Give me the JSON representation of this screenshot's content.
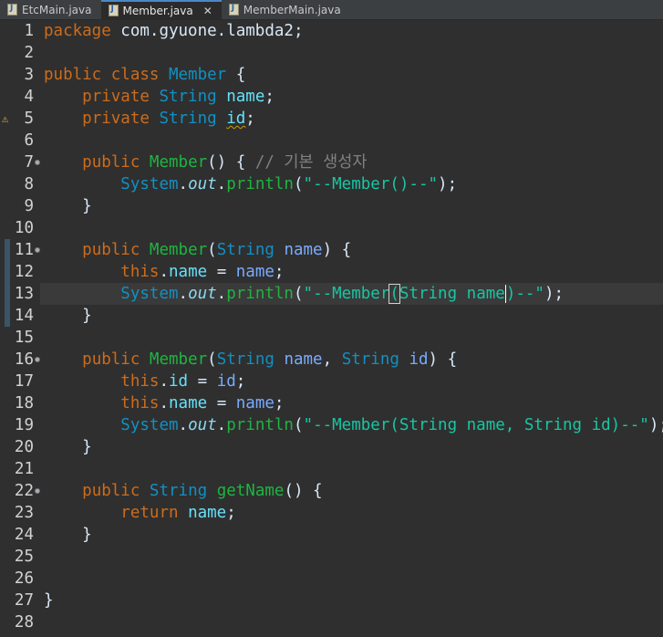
{
  "tabs": [
    {
      "label": "EtcMain.java",
      "active": false
    },
    {
      "label": "Member.java",
      "active": true,
      "close": "✕"
    },
    {
      "label": "MemberMain.java",
      "active": false
    }
  ],
  "gutter": {
    "fold_lines": [
      7,
      11,
      16,
      22
    ],
    "change_bar_lines": [
      11,
      12,
      13,
      14
    ],
    "warning_marker_line": 5,
    "warning_icon": "warning-lightbulb-icon"
  },
  "lines": [
    {
      "n": "1",
      "tokens": [
        {
          "t": "package",
          "c": "kw"
        },
        {
          "t": " com.gyuone.lambda2;",
          "c": "plain"
        }
      ]
    },
    {
      "n": "2",
      "tokens": []
    },
    {
      "n": "3",
      "tokens": [
        {
          "t": "public class ",
          "c": "kw"
        },
        {
          "t": "Member",
          "c": "ty"
        },
        {
          "t": " {",
          "c": "plain"
        }
      ]
    },
    {
      "n": "4",
      "tokens": [
        {
          "t": "    ",
          "c": "plain"
        },
        {
          "t": "private ",
          "c": "kw"
        },
        {
          "t": "String ",
          "c": "ty"
        },
        {
          "t": "name",
          "c": "fld"
        },
        {
          "t": ";",
          "c": "plain"
        }
      ]
    },
    {
      "n": "5",
      "tokens": [
        {
          "t": "    ",
          "c": "plain"
        },
        {
          "t": "private ",
          "c": "kw"
        },
        {
          "t": "String ",
          "c": "ty"
        },
        {
          "t": "id",
          "c": "fld squiggle"
        },
        {
          "t": ";",
          "c": "plain"
        }
      ]
    },
    {
      "n": "6",
      "tokens": []
    },
    {
      "n": "7",
      "tokens": [
        {
          "t": "    ",
          "c": "plain"
        },
        {
          "t": "public ",
          "c": "kw"
        },
        {
          "t": "Member",
          "c": "fn"
        },
        {
          "t": "() { ",
          "c": "plain"
        },
        {
          "t": "// 기본 생성자",
          "c": "cmt"
        }
      ]
    },
    {
      "n": "8",
      "tokens": [
        {
          "t": "        ",
          "c": "plain"
        },
        {
          "t": "System",
          "c": "ty"
        },
        {
          "t": ".",
          "c": "plain"
        },
        {
          "t": "out",
          "c": "static"
        },
        {
          "t": ".",
          "c": "plain"
        },
        {
          "t": "println",
          "c": "fn"
        },
        {
          "t": "(",
          "c": "plain"
        },
        {
          "t": "\"--Member()--\"",
          "c": "str"
        },
        {
          "t": ");",
          "c": "plain"
        }
      ]
    },
    {
      "n": "9",
      "tokens": [
        {
          "t": "    }",
          "c": "plain"
        }
      ]
    },
    {
      "n": "10",
      "tokens": []
    },
    {
      "n": "11",
      "tokens": [
        {
          "t": "    ",
          "c": "plain"
        },
        {
          "t": "public ",
          "c": "kw"
        },
        {
          "t": "Member",
          "c": "fn"
        },
        {
          "t": "(",
          "c": "plain"
        },
        {
          "t": "String ",
          "c": "ty"
        },
        {
          "t": "name",
          "c": "param"
        },
        {
          "t": ") {",
          "c": "plain"
        }
      ]
    },
    {
      "n": "12",
      "tokens": [
        {
          "t": "        ",
          "c": "plain"
        },
        {
          "t": "this",
          "c": "kw"
        },
        {
          "t": ".",
          "c": "plain"
        },
        {
          "t": "name",
          "c": "fld"
        },
        {
          "t": " = ",
          "c": "plain"
        },
        {
          "t": "name",
          "c": "param"
        },
        {
          "t": ";",
          "c": "plain"
        }
      ]
    },
    {
      "n": "13",
      "current": true,
      "tokens": [
        {
          "t": "        ",
          "c": "plain"
        },
        {
          "t": "System",
          "c": "ty"
        },
        {
          "t": ".",
          "c": "plain"
        },
        {
          "t": "out",
          "c": "static"
        },
        {
          "t": ".",
          "c": "plain"
        },
        {
          "t": "println",
          "c": "fn"
        },
        {
          "t": "(",
          "c": "plain"
        },
        {
          "t": "\"--Member",
          "c": "str"
        },
        {
          "t": "(",
          "c": "str bracket"
        },
        {
          "t": "String name",
          "c": "str"
        },
        {
          "t": ")",
          "c": "str caret"
        },
        {
          "t": "--\"",
          "c": "str"
        },
        {
          "t": ");",
          "c": "plain"
        }
      ]
    },
    {
      "n": "14",
      "tokens": [
        {
          "t": "    }",
          "c": "plain"
        }
      ]
    },
    {
      "n": "15",
      "tokens": []
    },
    {
      "n": "16",
      "tokens": [
        {
          "t": "    ",
          "c": "plain"
        },
        {
          "t": "public ",
          "c": "kw"
        },
        {
          "t": "Member",
          "c": "fn"
        },
        {
          "t": "(",
          "c": "plain"
        },
        {
          "t": "String ",
          "c": "ty"
        },
        {
          "t": "name",
          "c": "param"
        },
        {
          "t": ", ",
          "c": "plain"
        },
        {
          "t": "String ",
          "c": "ty"
        },
        {
          "t": "id",
          "c": "param"
        },
        {
          "t": ") {",
          "c": "plain"
        }
      ]
    },
    {
      "n": "17",
      "tokens": [
        {
          "t": "        ",
          "c": "plain"
        },
        {
          "t": "this",
          "c": "kw"
        },
        {
          "t": ".",
          "c": "plain"
        },
        {
          "t": "id",
          "c": "fld"
        },
        {
          "t": " = ",
          "c": "plain"
        },
        {
          "t": "id",
          "c": "param"
        },
        {
          "t": ";",
          "c": "plain"
        }
      ]
    },
    {
      "n": "18",
      "tokens": [
        {
          "t": "        ",
          "c": "plain"
        },
        {
          "t": "this",
          "c": "kw"
        },
        {
          "t": ".",
          "c": "plain"
        },
        {
          "t": "name",
          "c": "fld"
        },
        {
          "t": " = ",
          "c": "plain"
        },
        {
          "t": "name",
          "c": "param"
        },
        {
          "t": ";",
          "c": "plain"
        }
      ]
    },
    {
      "n": "19",
      "tokens": [
        {
          "t": "        ",
          "c": "plain"
        },
        {
          "t": "System",
          "c": "ty"
        },
        {
          "t": ".",
          "c": "plain"
        },
        {
          "t": "out",
          "c": "static"
        },
        {
          "t": ".",
          "c": "plain"
        },
        {
          "t": "println",
          "c": "fn"
        },
        {
          "t": "(",
          "c": "plain"
        },
        {
          "t": "\"--Member(String name, String id)--\"",
          "c": "str"
        },
        {
          "t": ");",
          "c": "plain"
        }
      ]
    },
    {
      "n": "20",
      "tokens": [
        {
          "t": "    }",
          "c": "plain"
        }
      ]
    },
    {
      "n": "21",
      "tokens": []
    },
    {
      "n": "22",
      "tokens": [
        {
          "t": "    ",
          "c": "plain"
        },
        {
          "t": "public ",
          "c": "kw"
        },
        {
          "t": "String ",
          "c": "ty"
        },
        {
          "t": "getName",
          "c": "fn"
        },
        {
          "t": "() {",
          "c": "plain"
        }
      ]
    },
    {
      "n": "23",
      "tokens": [
        {
          "t": "        ",
          "c": "plain"
        },
        {
          "t": "return ",
          "c": "kw"
        },
        {
          "t": "name",
          "c": "fld"
        },
        {
          "t": ";",
          "c": "plain"
        }
      ]
    },
    {
      "n": "24",
      "tokens": [
        {
          "t": "    }",
          "c": "plain"
        }
      ]
    },
    {
      "n": "25",
      "tokens": []
    },
    {
      "n": "26",
      "tokens": []
    },
    {
      "n": "27",
      "tokens": [
        {
          "t": "}",
          "c": "plain"
        }
      ]
    },
    {
      "n": "28",
      "tokens": []
    }
  ]
}
